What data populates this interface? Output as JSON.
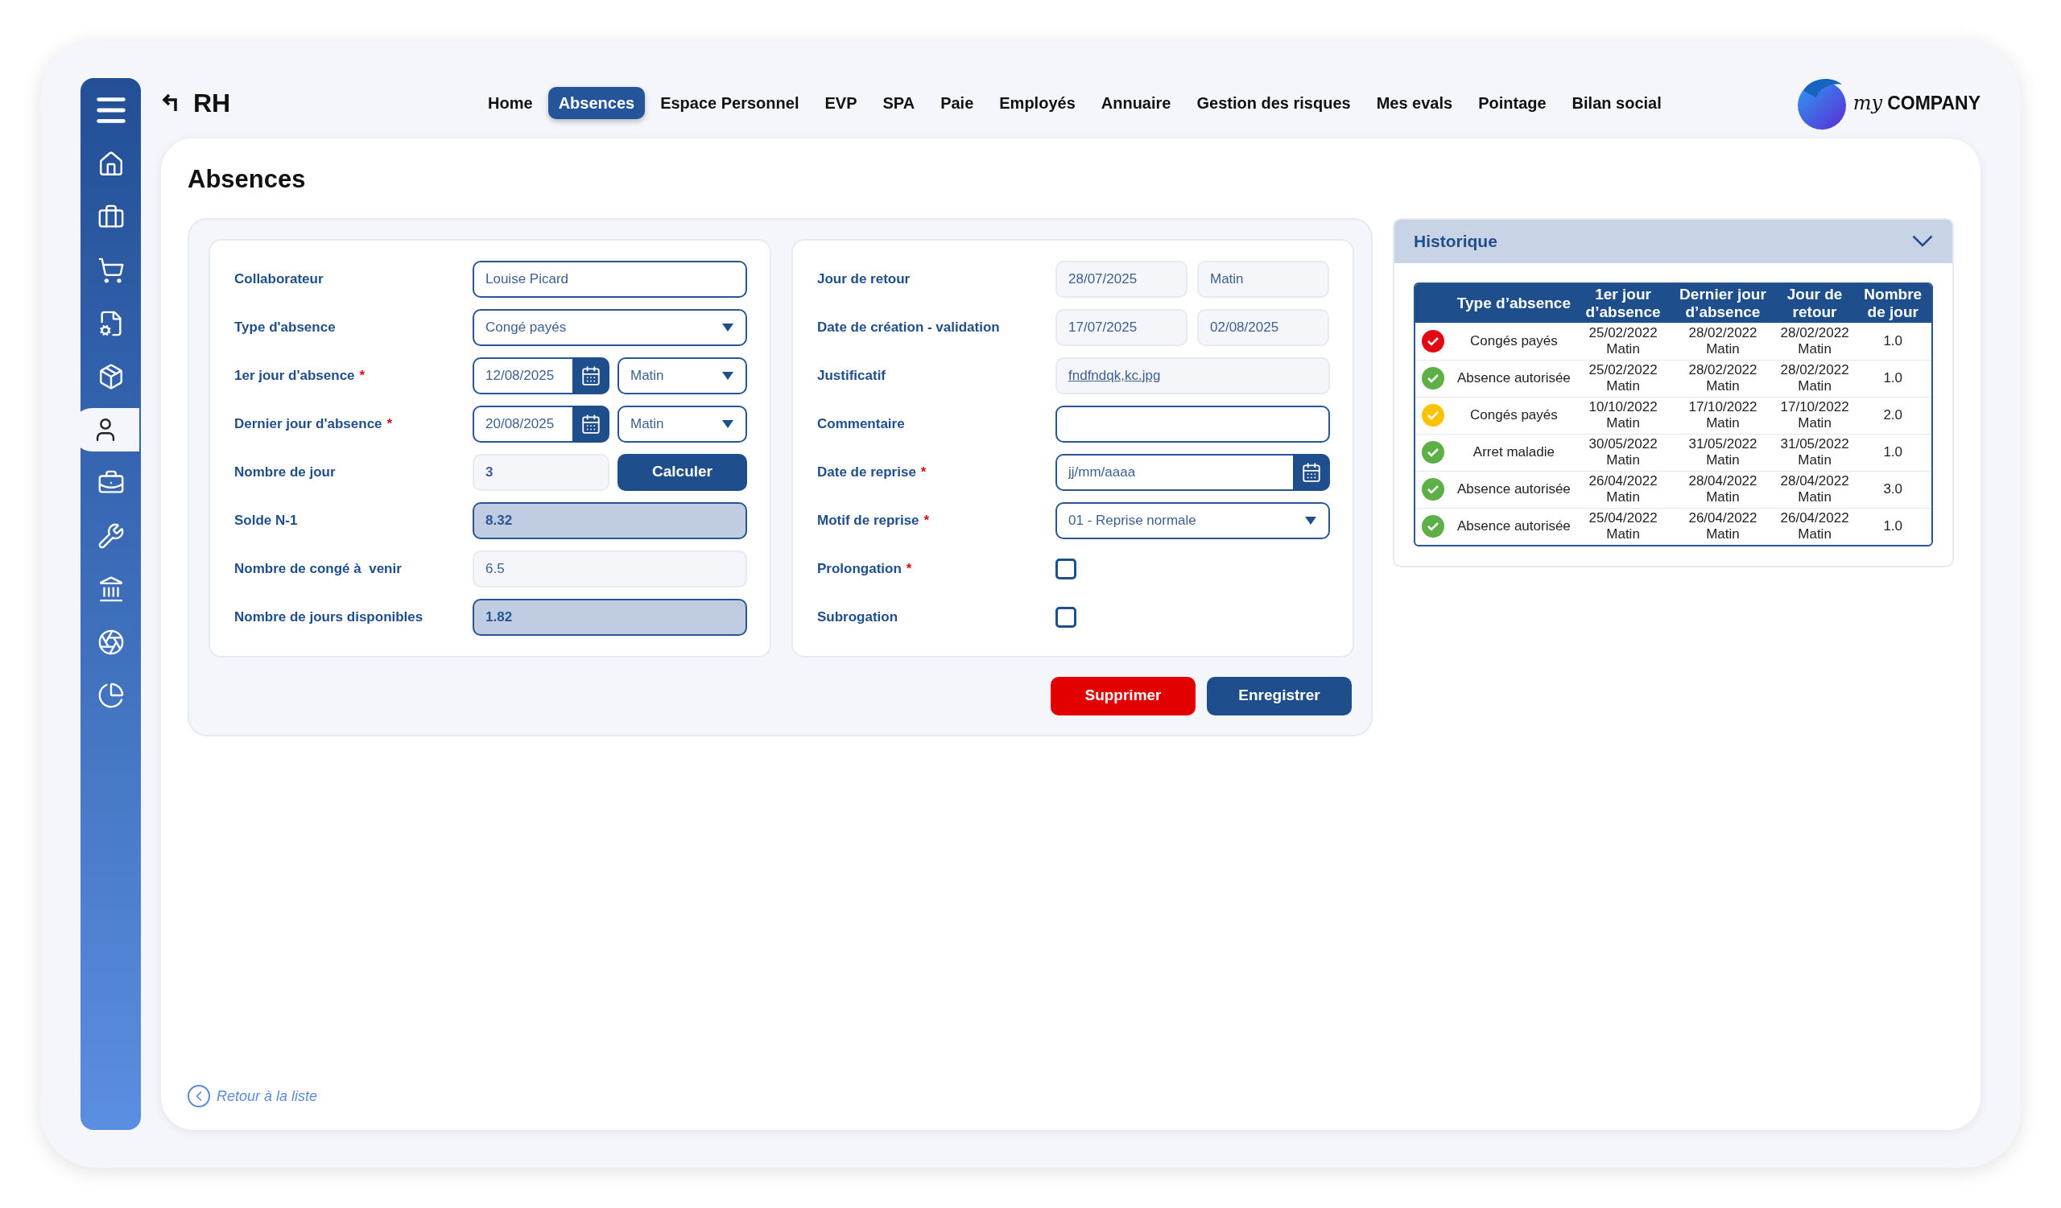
{
  "app": {
    "title": "RH"
  },
  "sidebar": {
    "items": [
      {
        "selected": false
      },
      {
        "selected": false
      },
      {
        "selected": false
      },
      {
        "selected": false
      },
      {
        "selected": false
      },
      {
        "selected": true
      },
      {
        "selected": false
      },
      {
        "selected": false
      },
      {
        "selected": false
      },
      {
        "selected": false
      },
      {
        "selected": false
      }
    ]
  },
  "nav": [
    {
      "label": "Home",
      "selected": false
    },
    {
      "label": "Absences",
      "selected": true
    },
    {
      "label": "Espace Personnel",
      "selected": false
    },
    {
      "label": "EVP",
      "selected": false
    },
    {
      "label": "SPA",
      "selected": false
    },
    {
      "label": "Paie",
      "selected": false
    },
    {
      "label": "Employés",
      "selected": false
    },
    {
      "label": "Annuaire",
      "selected": false
    },
    {
      "label": "Gestion des risques",
      "selected": false
    },
    {
      "label": "Mes evals",
      "selected": false
    },
    {
      "label": "Pointage",
      "selected": false
    },
    {
      "label": "Bilan social",
      "selected": false
    }
  ],
  "logo": {
    "prefix": "my",
    "name": "COMPANY"
  },
  "page": {
    "title": "Absences"
  },
  "form_left": [
    {
      "kind": "input",
      "label": "Collaborateur",
      "value": "Louise Picard"
    },
    {
      "kind": "select",
      "label": "Type d'absence",
      "value": "Congé payés"
    },
    {
      "kind": "date-select",
      "label": "1er jour d'absence",
      "required_mark": "*",
      "value": "12/08/2025",
      "period": "Matin"
    },
    {
      "kind": "date-select",
      "label": "Dernier jour d'absence",
      "required_mark": "*",
      "value": "20/08/2025",
      "period": "Matin"
    },
    {
      "kind": "number-button",
      "label": "Nombre de jour",
      "value": "3",
      "button": "Calculer"
    },
    {
      "kind": "highlight",
      "label": "Solde N-1",
      "value": "8.32"
    },
    {
      "kind": "readonly",
      "label": "Nombre de congé à  venir",
      "value": "6.5"
    },
    {
      "kind": "highlight",
      "label": "Nombre de jours disponibles",
      "value": "1.82"
    }
  ],
  "form_right": [
    {
      "kind": "readonly-pair",
      "label": "Jour de retour",
      "values": [
        "28/07/2025",
        "Matin"
      ]
    },
    {
      "kind": "readonly-pair",
      "label": "Date de création - validation",
      "values": [
        "17/07/2025",
        "02/08/2025"
      ]
    },
    {
      "kind": "file",
      "label": "Justificatif",
      "value": "fndfndqk,kc.jpg"
    },
    {
      "kind": "input",
      "label": "Commentaire"
    },
    {
      "kind": "date",
      "label": "Date de reprise",
      "required_mark": "*",
      "placeholder": "jj/mm/aaaa"
    },
    {
      "kind": "select",
      "label": "Motif de reprise",
      "required_mark": "*",
      "value": "01 - Reprise normale"
    },
    {
      "kind": "checkbox",
      "label": "Prolongation",
      "required_mark": "*",
      "checked": false
    },
    {
      "kind": "checkbox",
      "label": "Subrogation",
      "checked": false
    }
  ],
  "actions": [
    {
      "label": "Supprimer",
      "kind": "danger"
    },
    {
      "label": "Enregistrer",
      "kind": "primary"
    }
  ],
  "historique": {
    "title": "Historique",
    "expanded": true,
    "columns": [
      "Type d’absence",
      "1er jour d’absence",
      "Dernier jour d’absence",
      "Jour de retour",
      "Nombre de jour"
    ],
    "rows": [
      {
        "color": "#e30613",
        "type": "Congés payés",
        "first": [
          "25/02/2022",
          "Matin"
        ],
        "last": [
          "28/02/2022",
          "Matin"
        ],
        "return": [
          "28/02/2022",
          "Matin"
        ],
        "days": "1.0"
      },
      {
        "color": "#5cb046",
        "type": "Absence autorisée",
        "first": [
          "25/02/2022",
          "Matin"
        ],
        "last": [
          "28/02/2022",
          "Matin"
        ],
        "return": [
          "28/02/2022",
          "Matin"
        ],
        "days": "1.0"
      },
      {
        "color": "#fcc200",
        "type": "Congés payés",
        "first": [
          "10/10/2022",
          "Matin"
        ],
        "last": [
          "17/10/2022",
          "Matin"
        ],
        "return": [
          "17/10/2022",
          "Matin"
        ],
        "days": "2.0"
      },
      {
        "color": "#5cb046",
        "type": "Arret maladie",
        "first": [
          "30/05/2022",
          "Matin"
        ],
        "last": [
          "31/05/2022",
          "Matin"
        ],
        "return": [
          "31/05/2022",
          "Matin"
        ],
        "days": "1.0"
      },
      {
        "color": "#5cb046",
        "type": "Absence autorisée",
        "first": [
          "26/04/2022",
          "Matin"
        ],
        "last": [
          "28/04/2022",
          "Matin"
        ],
        "return": [
          "28/04/2022",
          "Matin"
        ],
        "days": "3.0"
      },
      {
        "color": "#5cb046",
        "type": "Absence autorisée",
        "first": [
          "25/04/2022",
          "Matin"
        ],
        "last": [
          "26/04/2022",
          "Matin"
        ],
        "return": [
          "26/04/2022",
          "Matin"
        ],
        "days": "1.0"
      }
    ]
  },
  "back_link": "Retour à la liste"
}
